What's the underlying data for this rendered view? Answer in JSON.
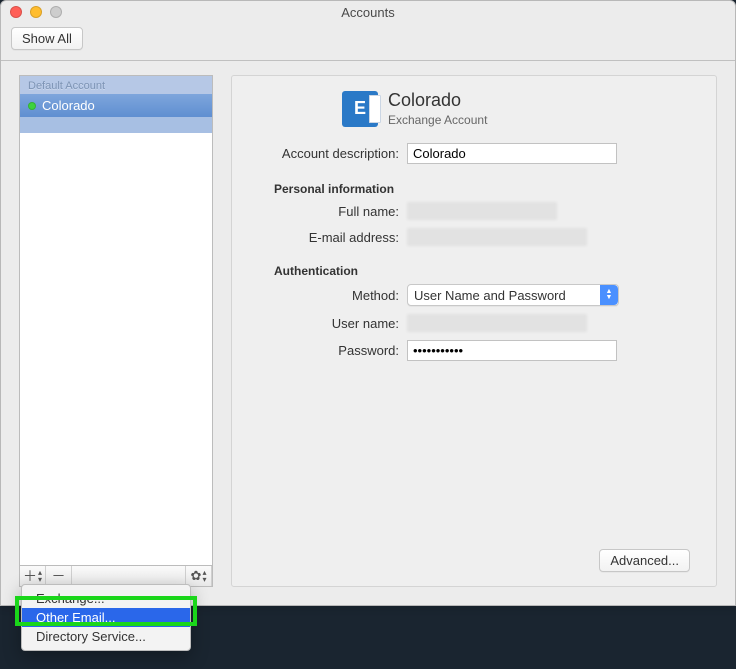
{
  "window": {
    "title": "Accounts",
    "show_all": "Show All"
  },
  "sidebar": {
    "header": "Default Account",
    "account_name": "Colorado"
  },
  "detail": {
    "title": "Colorado",
    "subtitle": "Exchange Account",
    "labels": {
      "description": "Account description:",
      "personal_info": "Personal information",
      "full_name": "Full name:",
      "email": "E-mail address:",
      "authentication": "Authentication",
      "method": "Method:",
      "user_name": "User name:",
      "password": "Password:",
      "advanced": "Advanced..."
    },
    "values": {
      "description": "Colorado",
      "method": "User Name and Password",
      "password": "•••••••••••"
    }
  },
  "menu": {
    "items": [
      "Exchange...",
      "Other Email...",
      "Directory Service..."
    ],
    "selected_index": 1
  }
}
